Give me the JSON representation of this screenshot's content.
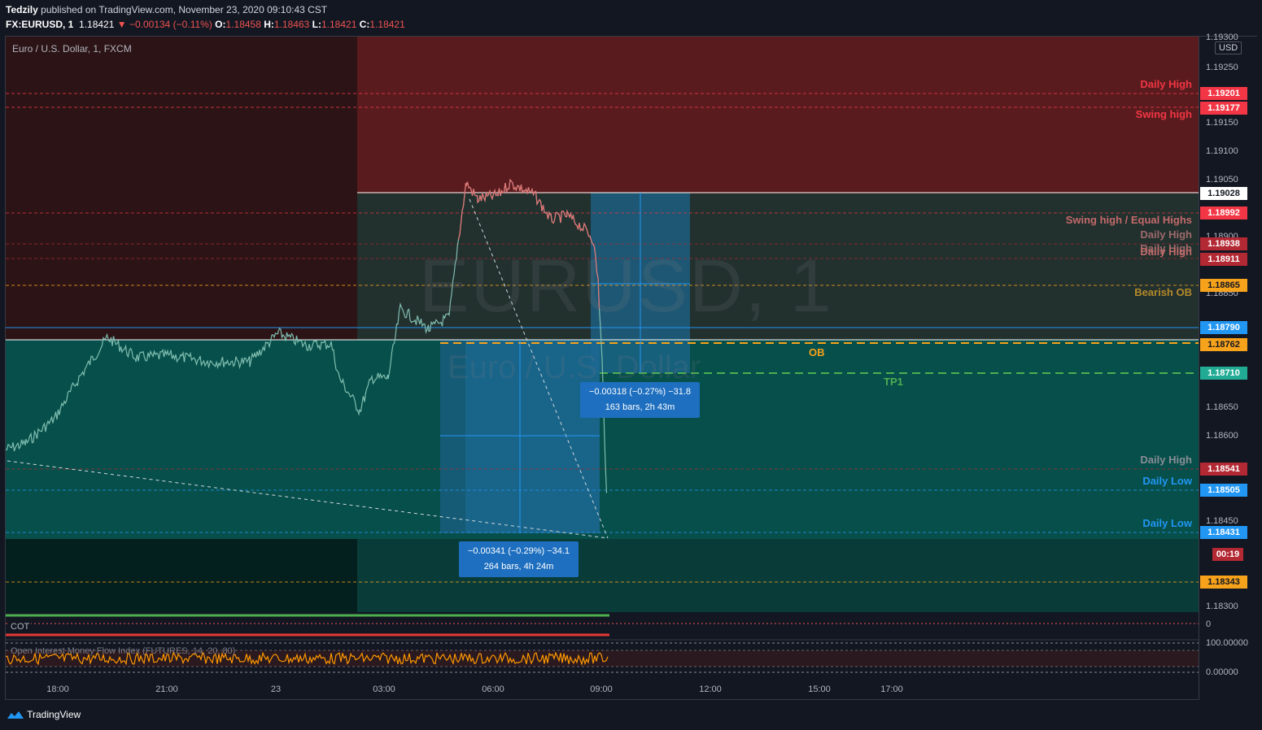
{
  "header": {
    "author": "Tedzily",
    "published_text": "published on TradingView.com, November 23, 2020 09:10:43 CST",
    "symbol_line": "FX:EURUSD, 1",
    "last": "1.18421",
    "change": "▼ −0.00134 (−0.11%)",
    "o_label": "O:",
    "o": "1.18458",
    "h_label": "H:",
    "h": "1.18463",
    "l_label": "L:",
    "l": "1.18421",
    "c_label": "C:",
    "c": "1.18421"
  },
  "chart": {
    "symbol_desc": "Euro / U.S. Dollar, 1, FXCM",
    "watermark": "EURUSD, 1",
    "watermark_sub": "Euro / U.S. Dollar",
    "currency": "USD"
  },
  "price_axis": {
    "ticks": [
      "1.19300",
      "1.19250",
      "1.19150",
      "1.19100",
      "1.19050",
      "1.18900",
      "1.18850",
      "1.18650",
      "1.18600",
      "1.18450",
      "1.18300"
    ],
    "labels": [
      {
        "text": "1.19201",
        "color": "#f23645"
      },
      {
        "text": "1.19177",
        "color": "#f23645"
      },
      {
        "text": "1.19028",
        "color": "#ffffff",
        "fg": "#131722"
      },
      {
        "text": "1.18992",
        "color": "#f23645"
      },
      {
        "text": "1.18938",
        "color": "#b22833"
      },
      {
        "text": "1.18911",
        "color": "#b22833"
      },
      {
        "text": "1.18865",
        "color": "#f7a21b",
        "fg": "#131722"
      },
      {
        "text": "1.18790",
        "color": "#2196f3"
      },
      {
        "text": "1.18762",
        "color": "#f7a21b",
        "fg": "#131722"
      },
      {
        "text": "1.18710",
        "color": "#22ab94"
      },
      {
        "text": "1.18541",
        "color": "#b22833"
      },
      {
        "text": "1.18505",
        "color": "#2196f3"
      },
      {
        "text": "1.18431",
        "color": "#2196f3"
      },
      {
        "text": "00:19",
        "color": "#b22833"
      },
      {
        "text": "1.18343",
        "color": "#f7a21b",
        "fg": "#131722"
      }
    ]
  },
  "level_labels": [
    {
      "text": "Daily High",
      "color": "#f23645"
    },
    {
      "text": "Swing high",
      "color": "#f23645"
    },
    {
      "text": "Swing high / Equal Highs",
      "color": "#c36a6a"
    },
    {
      "text": "Daily High",
      "color": "#9e6b6b"
    },
    {
      "text": "Daily High",
      "color": "#9e6b6b"
    },
    {
      "text": "Daily High",
      "color": "#c36a6a"
    },
    {
      "text": "Bearish OB",
      "color": "#b58a2a"
    },
    {
      "text": "OB",
      "color": "#f7a21b"
    },
    {
      "text": "TP1",
      "color": "#4caf50"
    },
    {
      "text": "Daily High",
      "color": "#8a8d96"
    },
    {
      "text": "Daily Low",
      "color": "#2196f3"
    },
    {
      "text": "Daily Low",
      "color": "#2196f3"
    }
  ],
  "measures": [
    {
      "line1": "−0.00318 (−0.27%) −31.8",
      "line2": "163 bars, 2h 43m"
    },
    {
      "line1": "−0.00341 (−0.29%) −34.1",
      "line2": "264 bars, 4h 24m"
    }
  ],
  "indicators": {
    "cot_label": "COT",
    "cot_value": "0",
    "mfi_label": "Open Interest Money Flow Index (FUTURES, 14, 20, 80)",
    "mfi_top": "100.00000",
    "mfi_bottom": "0.00000"
  },
  "time_axis": [
    "18:00",
    "21:00",
    "23",
    "03:00",
    "06:00",
    "09:00",
    "12:00",
    "15:00",
    "17:00"
  ],
  "footer": {
    "brand": "TradingView"
  }
}
